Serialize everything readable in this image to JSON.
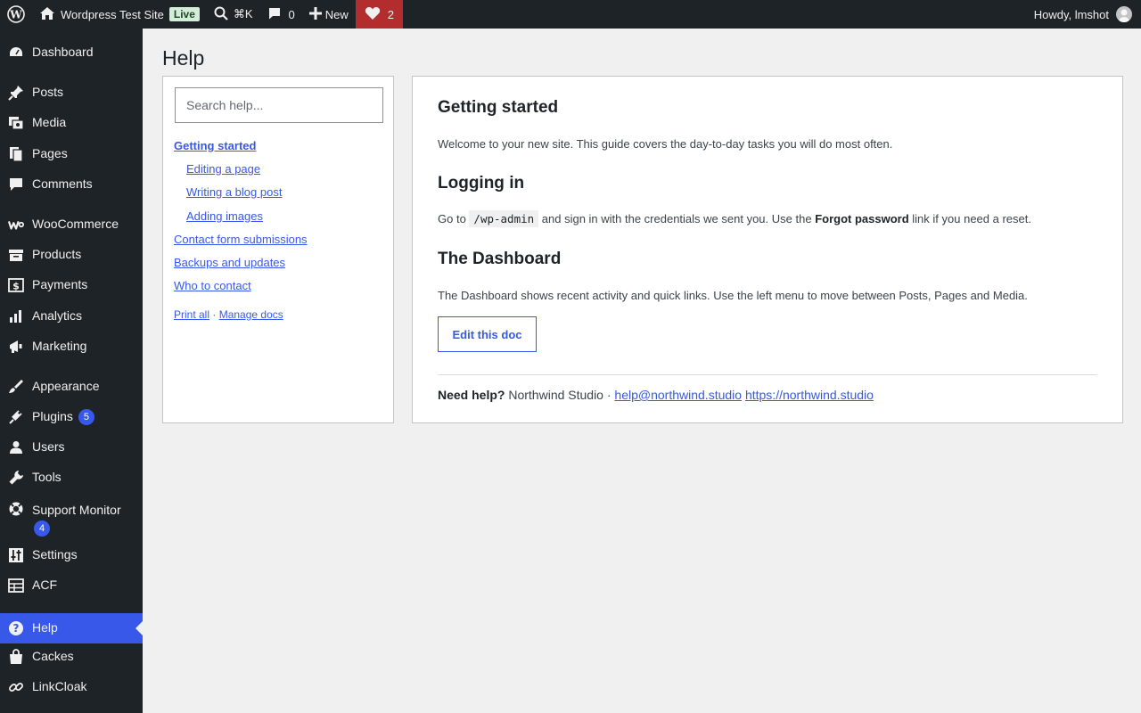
{
  "admin_bar": {
    "site_name": "Wordpress Test Site",
    "live_badge": "Live",
    "search_shortcut": "⌘K",
    "comments_count": "0",
    "new_label": "New",
    "hearts_count": "2",
    "greeting": "Howdy, lmshot"
  },
  "sidebar": {
    "items": [
      {
        "label": "Dashboard",
        "icon": "dashboard-icon"
      },
      {
        "label": "Posts",
        "icon": "pin-icon"
      },
      {
        "label": "Media",
        "icon": "media-icon"
      },
      {
        "label": "Pages",
        "icon": "pages-icon"
      },
      {
        "label": "Comments",
        "icon": "comment-icon"
      },
      {
        "label": "WooCommerce",
        "icon": "woo-icon"
      },
      {
        "label": "Products",
        "icon": "archive-icon"
      },
      {
        "label": "Payments",
        "icon": "dollar-icon"
      },
      {
        "label": "Analytics",
        "icon": "chart-bar-icon"
      },
      {
        "label": "Marketing",
        "icon": "megaphone-icon"
      },
      {
        "label": "Appearance",
        "icon": "brush-icon"
      },
      {
        "label": "Plugins",
        "icon": "plug-icon",
        "badge": "5"
      },
      {
        "label": "Users",
        "icon": "user-icon"
      },
      {
        "label": "Tools",
        "icon": "wrench-icon"
      },
      {
        "label": "Support Monitor",
        "icon": "lifebuoy-icon",
        "badge": "4"
      },
      {
        "label": "Settings",
        "icon": "sliders-icon"
      },
      {
        "label": "ACF",
        "icon": "table-icon"
      },
      {
        "label": "Help",
        "icon": "help-icon"
      },
      {
        "label": "Cackes",
        "icon": "bag-icon"
      },
      {
        "label": "LinkCloak",
        "icon": "link-icon"
      }
    ]
  },
  "page": {
    "title": "Help"
  },
  "toc": {
    "search_placeholder": "Search help...",
    "links": [
      {
        "label": "Getting started"
      },
      {
        "label": "Editing a page"
      },
      {
        "label": "Writing a blog post"
      },
      {
        "label": "Adding images"
      },
      {
        "label": "Contact form submissions"
      },
      {
        "label": "Backups and updates"
      },
      {
        "label": "Who to contact"
      }
    ],
    "print_all": "Print all",
    "separator": "·",
    "manage_docs": "Manage docs"
  },
  "doc": {
    "section1_title": "Getting started",
    "section1_text": "Welcome to your new site. This guide covers the day-to-day tasks you will do most often.",
    "section2_title": "Logging in",
    "section2_text_a": "Go to",
    "section2_code": "/wp-admin",
    "section2_text_b": "and sign in with the credentials we sent you. Use the",
    "section2_strong": "Forgot password",
    "section2_text_c": "link if you need a reset.",
    "section3_title": "The Dashboard",
    "section3_text": "The Dashboard shows recent activity and quick links. Use the left menu to move between Posts, Pages and Media.",
    "edit_button": "Edit this doc",
    "footer_label": "Need help?",
    "footer_company": "Northwind Studio ·",
    "footer_email": "help@northwind.studio",
    "footer_url": "https://northwind.studio"
  },
  "colors": {
    "admin_bg": "#1d2327",
    "accent": "#3858e9",
    "heart_bg": "#b32d2e"
  }
}
